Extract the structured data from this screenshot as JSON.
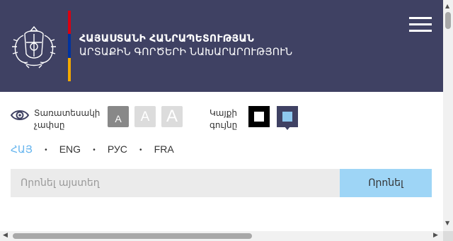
{
  "header": {
    "title_line1": "ՀԱՅԱՍՏԱՆԻ ՀԱՆՐԱՊԵՏՈՒԹՅԱՆ",
    "title_line2": "ԱՐՏԱՔԻՆ ԳՈՐԾԵՐԻ ՆԱԽԱՐԱՐՈՒԹՅՈՒՆ",
    "background": "#3f4163",
    "flag_colors": [
      "#d90012",
      "#0033a0",
      "#f2a800"
    ],
    "emblem_icon": "coat-of-arms-emblem",
    "menu_icon": "hamburger-menu-icon"
  },
  "accessibility": {
    "icon": "eye-icon",
    "label_line1": "Տառատեսակի",
    "label_line2": "չափսը",
    "font_sizes": [
      "A",
      "A",
      "A"
    ],
    "color_label_line1": "Կայքի",
    "color_label_line2": "գույնը"
  },
  "languages": {
    "items": [
      "ՀԱՅ",
      "ENG",
      "РУС",
      "FRA"
    ],
    "active": "ՀԱՅ",
    "separator": "•"
  },
  "search": {
    "placeholder": "Որոնել այստեղ",
    "value": "",
    "button_label": "Որոնել"
  },
  "colors": {
    "accent": "#62b3ee",
    "search_button": "#9ed5f6",
    "input_bg": "#ebebeb"
  }
}
